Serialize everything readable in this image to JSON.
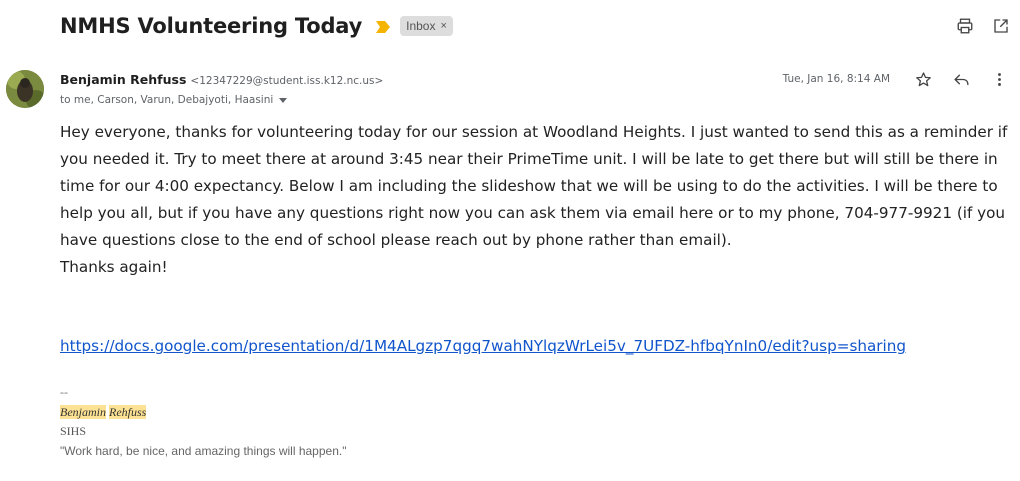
{
  "email": {
    "subject": "NMHS Volunteering Today",
    "label": "Inbox",
    "label_remove": "×",
    "sender": {
      "name": "Benjamin Rehfuss",
      "email": "<12347229@student.iss.k12.nc.us>"
    },
    "recipients": "to me, Carson, Varun, Debajyoti, Haasini",
    "date": "Tue, Jan 16, 8:14 AM",
    "body": [
      "Hey everyone, thanks for volunteering today for our session at Woodland Heights. I just wanted to send this as a reminder if you needed it. Try to meet there at around 3:45 near their PrimeTime unit. I will be late to get there but will still be there in time for our 4:00 expectancy.  Below I am including the slideshow that we will be using to do the activities. I will be there to help you all, but if you have any questions right now you can ask them via email here or to my phone, 704-977-9921 (if you have questions close to the end of school please reach out by phone rather than email).",
      "Thanks again!"
    ],
    "link": "https://docs.google.com/presentation/d/1M4ALgzp7qgq7wahNYlqzWrLei5v_7UFDZ-hfbqYnIn0/edit?usp=sharing",
    "signature": {
      "separator": "--",
      "first_name": "Benjamin",
      "last_name": "Rehfuss",
      "school": "SIHS",
      "quote": "\"Work hard, be nice, and amazing things will happen.\""
    }
  },
  "icons": {
    "print": "print-icon",
    "open_new_window": "open-in-new-icon",
    "star": "star-icon",
    "reply": "reply-icon",
    "more": "more-vert-icon",
    "importance": "importance-marker-icon"
  },
  "colors": {
    "importance": "#f4b400",
    "link": "#1155cc",
    "highlight": "#fde293",
    "chip": "#dddddd"
  }
}
